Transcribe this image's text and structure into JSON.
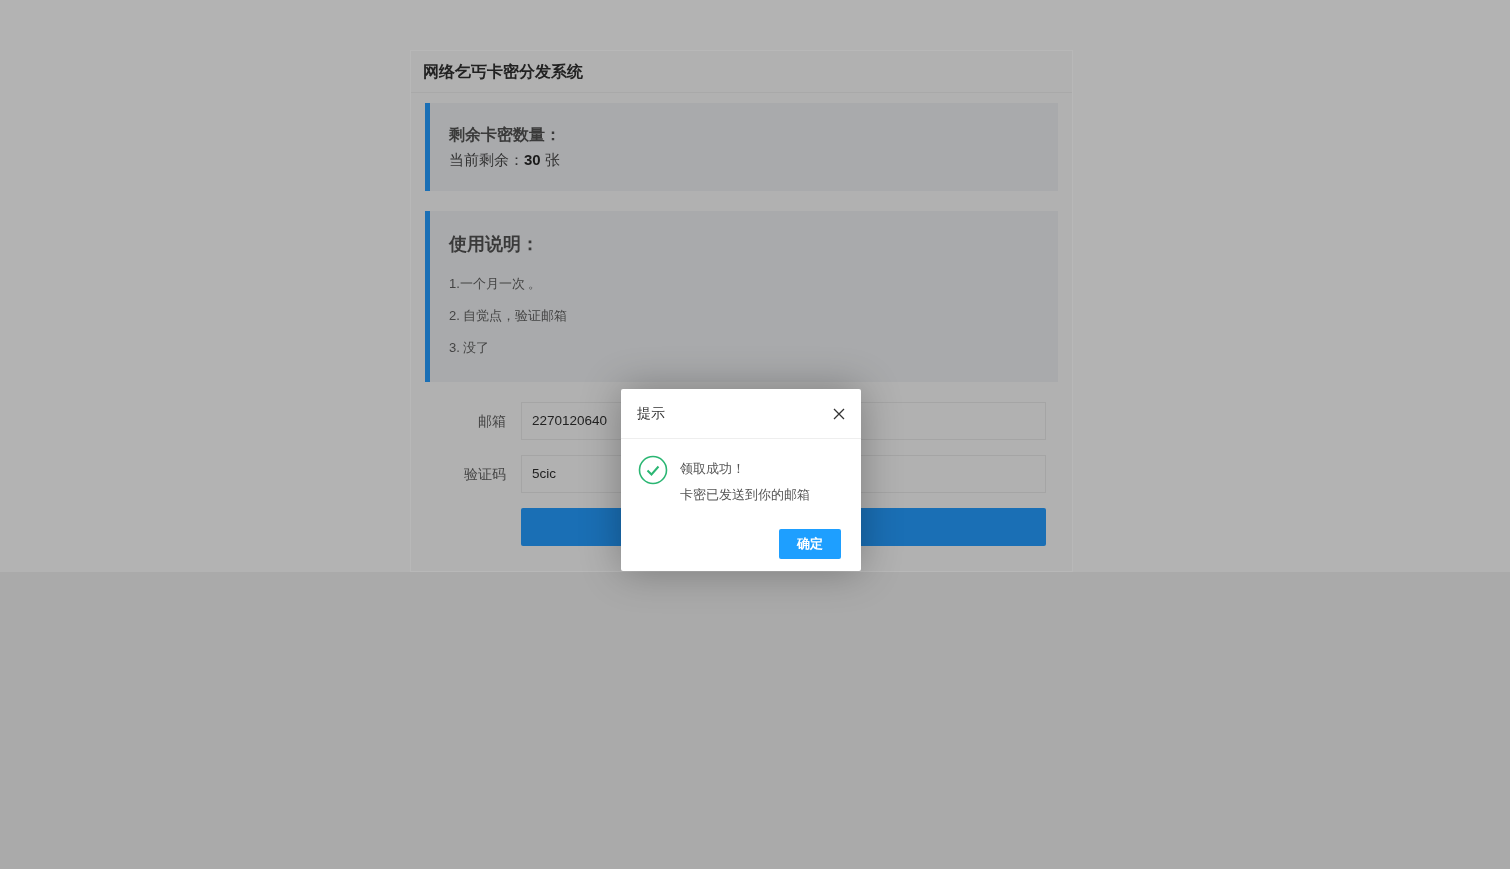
{
  "page": {
    "title": "网络乞丐卡密分发系统"
  },
  "stock": {
    "heading": "剩余卡密数量：",
    "label": "当前剩余：",
    "count": "30",
    "unit": "张"
  },
  "instructions": {
    "heading": "使用说明：",
    "items": [
      "1.一个月一次 。",
      "2. 自觉点，验证邮箱",
      "3. 没了"
    ]
  },
  "form": {
    "fields": [
      {
        "label": "邮箱",
        "value": "2270120640"
      },
      {
        "label": "验证码",
        "value": "5cic"
      }
    ]
  },
  "dialog": {
    "title": "提示",
    "message": "领取成功！",
    "detail": "卡密已发送到你的邮箱",
    "confirm": "确定"
  }
}
